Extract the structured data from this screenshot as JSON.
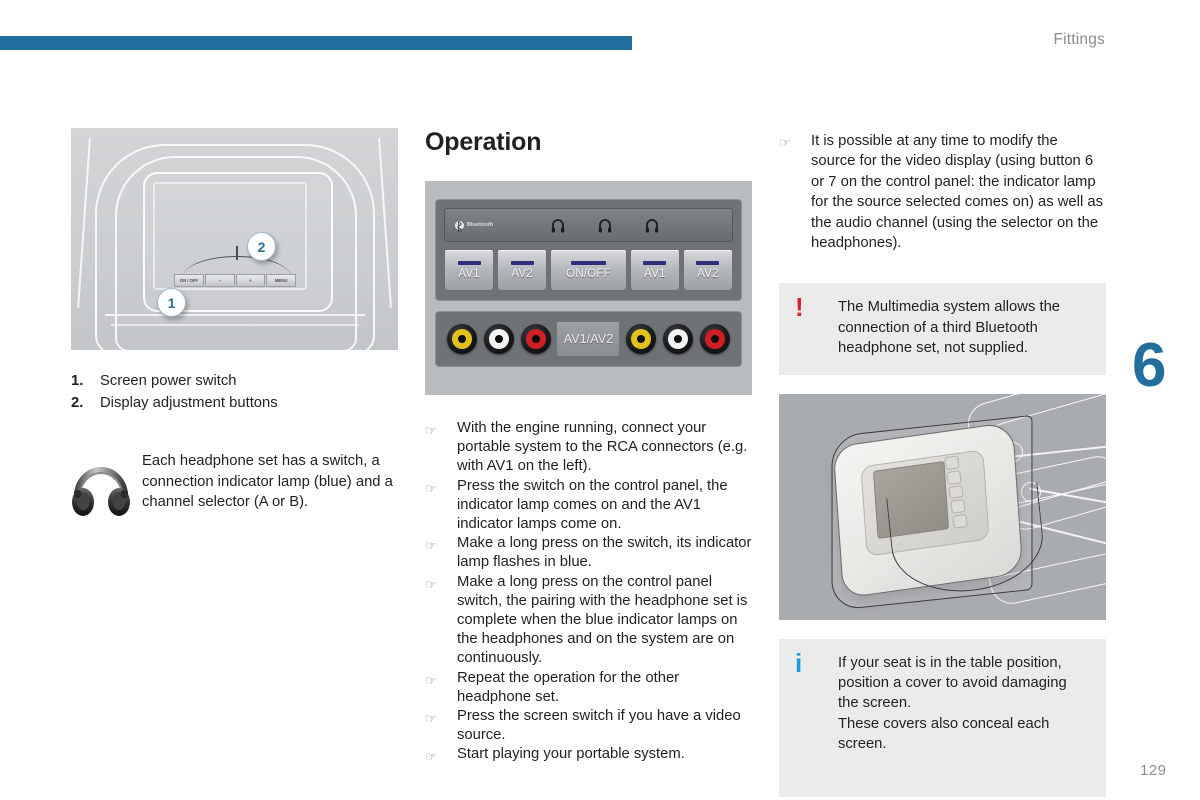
{
  "header": {
    "title": "Fittings",
    "rule_color": "#226e9c"
  },
  "chapter": {
    "number": "6",
    "color": "#226e9c"
  },
  "footer": {
    "page_number": "129"
  },
  "left_column": {
    "figure": {
      "name": "headrest-screen-illustration",
      "buttons": [
        "ON / OFF",
        "–",
        "+",
        "MENU"
      ],
      "callouts": [
        "1",
        "2"
      ]
    },
    "numbered_list": [
      {
        "num": "1.",
        "text": "Screen power switch"
      },
      {
        "num": "2.",
        "text": "Display adjustment buttons"
      }
    ],
    "headphone_note": {
      "icon": "headphones-icon",
      "text": "Each headphone set has a switch, a connection indicator lamp (blue) and a channel selector (A or B)."
    }
  },
  "middle_column": {
    "heading": "Operation",
    "figure": {
      "name": "multimedia-control-panel",
      "bluetooth_label": "Bluetooth",
      "lamp_icons": [
        "headphone-lamp-icon",
        "headphone-lamp-icon",
        "headphone-lamp-icon"
      ],
      "buttons": [
        "AV1",
        "AV2",
        "ON/OFF",
        "AV1",
        "AV2"
      ],
      "rca_label": "AV1/AV2",
      "rca_left": [
        "yellow",
        "white",
        "red"
      ],
      "rca_right": [
        "yellow",
        "white",
        "red"
      ],
      "rca_colors": {
        "yellow": "#e3c11d",
        "white": "#f2f2f0",
        "red": "#cf1f22"
      },
      "lamp_color": "#2c2f7a"
    },
    "bullets": [
      "With the engine running, connect your portable system to the RCA connectors (e.g. with AV1 on the left).",
      "Press the switch on the control panel, the indicator lamp comes on and the AV1 indicator lamps come on.",
      "Make a long press on the switch, its indicator lamp flashes in blue.",
      "Make a long press on the control panel switch, the pairing with the headphone set is complete when the blue indicator lamps on the headphones and on the system are on continuously.",
      "Repeat the operation for the other headphone set.",
      "Press the screen switch if you have a video source.",
      "Start playing your portable system."
    ]
  },
  "right_column": {
    "bullets": [
      "It is possible at any time to modify the source for the video display (using button 6 or 7 on the control panel: the indicator lamp for the source selected comes on) as well as the audio channel (using the selector on the headphones)."
    ],
    "warning_box": {
      "icon": "warning-exclamation-icon",
      "icon_glyph": "!",
      "icon_color": "#d8232a",
      "text": "The Multimedia system allows the connection of a third Bluetooth headphone set, not supplied."
    },
    "figure": {
      "name": "seat-back-screen-cover-illustration"
    },
    "info_box": {
      "icon": "information-icon",
      "icon_glyph": "i",
      "icon_color": "#1c9ad6",
      "text_line1": "If your seat is in the table position, position a cover to avoid damaging the screen.",
      "text_line2": "These covers also conceal each screen."
    }
  }
}
